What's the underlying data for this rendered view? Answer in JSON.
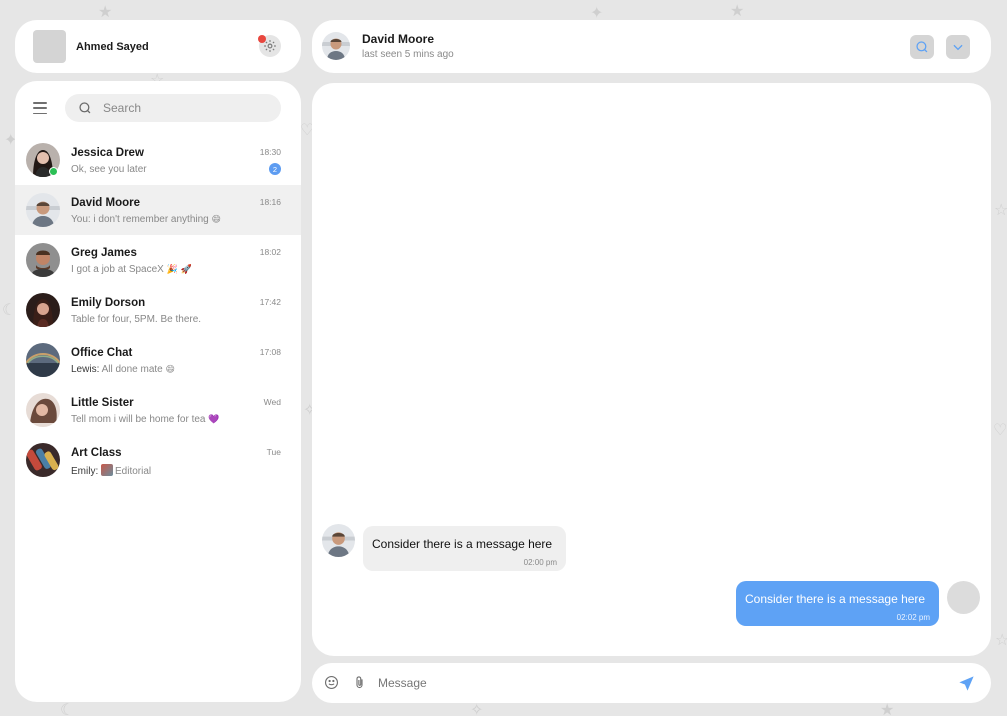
{
  "profile": {
    "name": "Ahmed Sayed",
    "settings_icon": "gear-icon",
    "notification_color": "#e8473e"
  },
  "header": {
    "name": "David Moore",
    "status": "last seen 5 mins ago",
    "search_icon": "search-icon",
    "more_icon": "chevron-down-icon"
  },
  "sidebar": {
    "search_placeholder": "Search",
    "chats": [
      {
        "name": "Jessica Drew",
        "preview": "Ok, see you later",
        "time": "18:30",
        "unread": "2",
        "online": true
      },
      {
        "name": "David Moore",
        "preview": "You: i don't remember anything",
        "emoji": "😄",
        "time": "18:16",
        "active": true
      },
      {
        "name": "Greg James",
        "preview": "I got a job at SpaceX",
        "emoji": "🎉 🚀",
        "time": "18:02"
      },
      {
        "name": "Emily Dorson",
        "preview": "Table for four, 5PM. Be there.",
        "time": "17:42"
      },
      {
        "name": "Office Chat",
        "sender": "Lewis:",
        "preview": "All done mate",
        "emoji": "😄",
        "time": "17:08"
      },
      {
        "name": "Little Sister",
        "preview": "Tell mom i will be home for tea",
        "emoji": "💜",
        "time": "Wed"
      },
      {
        "name": "Art Class",
        "sender": "Emily:",
        "preview": "Editorial",
        "time": "Tue"
      }
    ]
  },
  "messages": [
    {
      "direction": "in",
      "text": "Consider there is a message here",
      "time": "02:00 pm"
    },
    {
      "direction": "out",
      "text": "Consider there is a message here",
      "time": "02:02 pm"
    }
  ],
  "composer": {
    "placeholder": "Message",
    "accent": "#5ea2f5"
  },
  "colors": {
    "accent": "#5ea2f5",
    "online": "#2bbf55",
    "badge": "#5d9cf1"
  }
}
